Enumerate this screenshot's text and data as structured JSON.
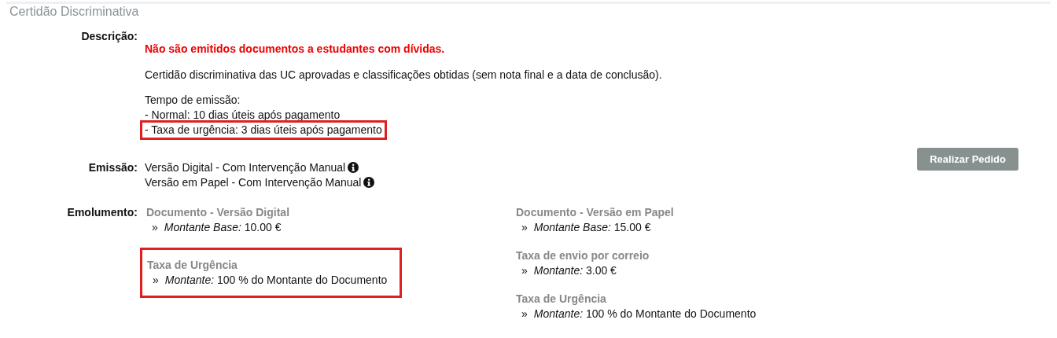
{
  "section_title": "Certidão Discriminativa",
  "description": {
    "label": "Descrição:",
    "warning": "Não são emitidos documentos a estudantes com dívidas.",
    "text": "Certidão discriminativa das UC aprovadas e classificações obtidas (sem nota final e a data de conclusão).",
    "emission_time": [
      {
        "text": "Tempo de emissão:",
        "highlighted": false
      },
      {
        "text": "- Normal: 10 dias úteis após pagamento",
        "highlighted": false
      },
      {
        "text": "- Taxa de urgência: 3 dias úteis após pagamento",
        "highlighted": true
      }
    ]
  },
  "emission": {
    "label": "Emissão:",
    "options": [
      {
        "text": "Versão Digital - Com Intervenção Manual"
      },
      {
        "text": "Versão em Papel - Com Intervenção Manual"
      }
    ],
    "button": "Realizar Pedido"
  },
  "fees": {
    "label": "Emolumento:",
    "columns": [
      [
        {
          "title": "Documento - Versão Digital",
          "bullet": "»",
          "detail": "*Montante Base:* 10.00 €",
          "highlighted": false
        },
        {
          "title": "Taxa de Urgência",
          "bullet": "»",
          "detail": "*Montante:* 100 % do Montante do Documento",
          "highlighted": true
        }
      ],
      [
        {
          "title": "Documento - Versão em Papel",
          "bullet": "»",
          "detail": "*Montante Base:* 15.00 €",
          "highlighted": false
        },
        {
          "title": "Taxa de envio por correio",
          "bullet": "»",
          "detail": "*Montante:* 3.00 €",
          "highlighted": false
        },
        {
          "title": "Taxa de Urgência",
          "bullet": "»",
          "detail": "*Montante:* 100 % do Montante do Documento",
          "highlighted": false
        }
      ]
    ]
  }
}
